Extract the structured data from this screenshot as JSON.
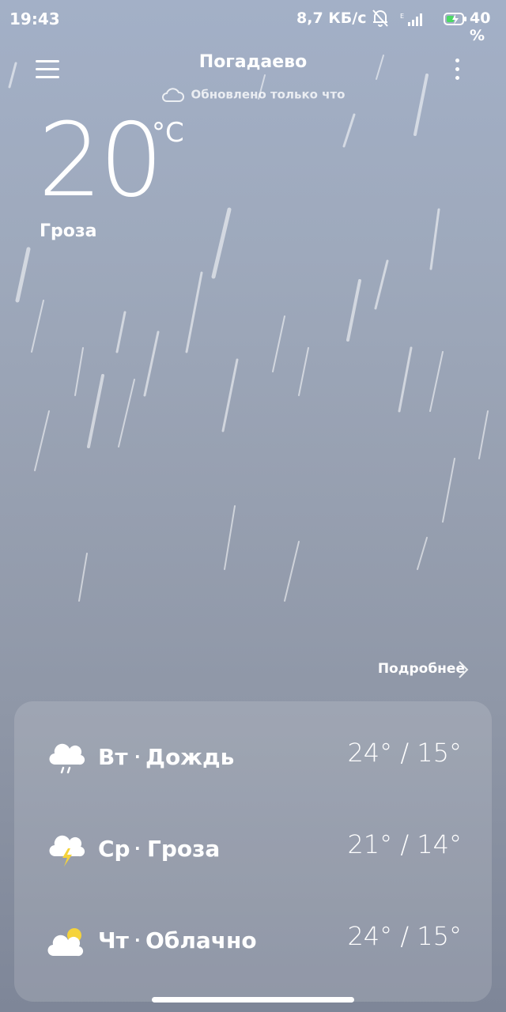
{
  "status_bar": {
    "time": "19:43",
    "speed": "8,7 КБ/с",
    "battery": "40 %"
  },
  "header": {
    "city": "Погадаево",
    "updated": "Обновлено только что"
  },
  "current": {
    "temperature": "20",
    "unit": "°C",
    "condition": "Гроза"
  },
  "details_link": "Подробнее",
  "forecast": [
    {
      "day": "Вт",
      "condition": "Дождь",
      "range": "24° / 15°",
      "icon": "rain-cloud-icon"
    },
    {
      "day": "Ср",
      "condition": "Гроза",
      "range": "21° / 14°",
      "icon": "thunderstorm-icon"
    },
    {
      "day": "Чт",
      "condition": "Облачно",
      "range": "24° / 15°",
      "icon": "partly-cloudy-icon"
    }
  ],
  "colors": {
    "background_top": "#a3b0c7",
    "background_bottom": "#7e8698",
    "sun": "#f5d33b",
    "battery_accent": "#4cd964"
  }
}
